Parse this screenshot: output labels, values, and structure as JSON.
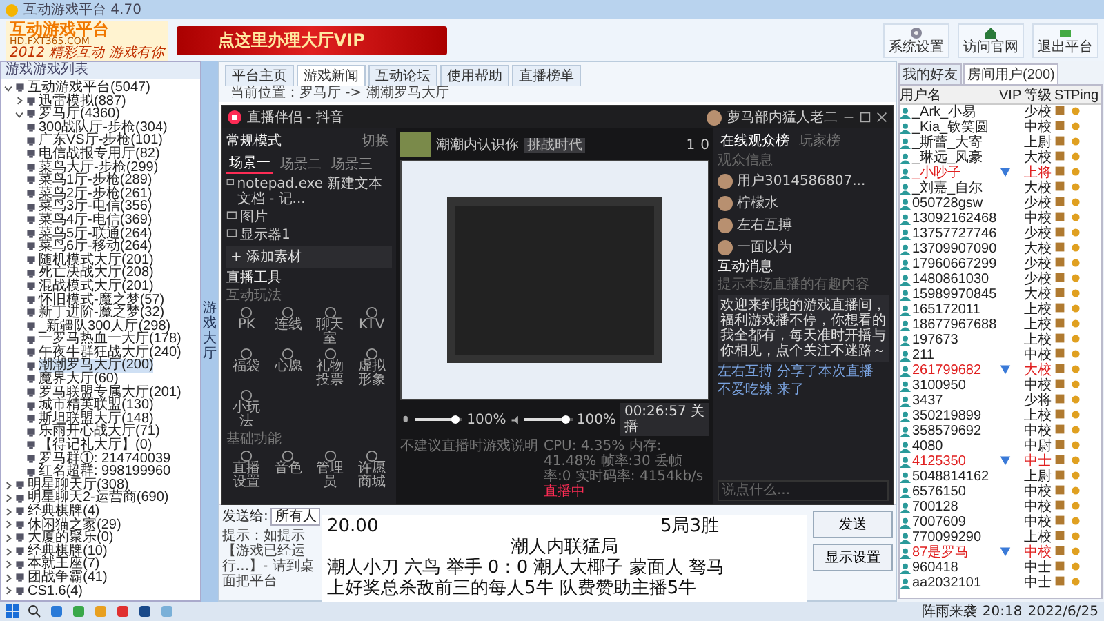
{
  "window": {
    "title": "互动游戏平台 4.70"
  },
  "header": {
    "logo": "互动游戏平台",
    "logo_url": "HD.FXT365.COM",
    "slogan": "2012 精彩互动 游戏有你",
    "banner": "点这里办理大厅VIP",
    "buttons": [
      "系统设置",
      "访问官网",
      "退出平台"
    ]
  },
  "tree": {
    "title": "游戏游戏列表",
    "items": [
      {
        "label": "互动游戏平台(5047)",
        "expanded": true,
        "selected": false,
        "children": [
          {
            "label": "迅雷模拟(887)",
            "expanded": false,
            "selected": false
          },
          {
            "label": "罗马厅(4360)",
            "expanded": true,
            "selected": false,
            "children": [
              {
                "label": "300战队厅-步枪(304)",
                "selected": false
              },
              {
                "label": "广东VS厅-步枪(101)",
                "selected": false
              },
              {
                "label": "电信战报专用厅(82)",
                "selected": false
              },
              {
                "label": "菜鸟大厅-步枪(299)",
                "selected": false
              },
              {
                "label": "菜鸟1厅-步枪(289)",
                "selected": false
              },
              {
                "label": "菜鸟2厅-步枪(261)",
                "selected": false
              },
              {
                "label": "菜鸟3厅-电信(356)",
                "selected": false
              },
              {
                "label": "菜鸟4厅-电信(369)",
                "selected": false
              },
              {
                "label": "菜鸟5厅-联通(264)",
                "selected": false
              },
              {
                "label": "菜鸟6厅-移动(264)",
                "selected": false
              },
              {
                "label": "随机模式大厅(201)",
                "selected": false
              },
              {
                "label": "死亡决战大厅(208)",
                "selected": false
              },
              {
                "label": "混战模式大厅(201)",
                "selected": false
              },
              {
                "label": "怀旧模式-魔之梦(57)",
                "selected": false
              },
              {
                "label": "新丁进阶-魔之梦(32)",
                "selected": false
              },
              {
                "label": "_新疆队300人厅(298)",
                "selected": false
              },
              {
                "label": "一罗马热血一大厅(178)",
                "selected": false
              },
              {
                "label": "午夜牛群狂战大厅(240)",
                "selected": false
              },
              {
                "label": "潮潮罗马大厅(200)",
                "selected": true
              },
              {
                "label": "魔界大厅(60)",
                "selected": false
              },
              {
                "label": "罗马联盟专属大厅(201)",
                "selected": false
              },
              {
                "label": "城市精英联盟(130)",
                "selected": false
              },
              {
                "label": "斯坦联盟大厅(148)",
                "selected": false
              },
              {
                "label": "乐雨开心战大厅(71)",
                "selected": false
              },
              {
                "label": "【得记礼大厅】(0)",
                "selected": false
              },
              {
                "label": "罗马群①: 214740039",
                "selected": false
              },
              {
                "label": "红名超群: 998199960",
                "selected": false
              }
            ]
          }
        ]
      },
      {
        "label": "明星聊天厅(308)",
        "expanded": false,
        "selected": false
      },
      {
        "label": "明星聊天2-运营商(690)",
        "expanded": false,
        "selected": false
      },
      {
        "label": "经典棋牌(4)",
        "expanded": false,
        "selected": false
      },
      {
        "label": "休闲猫之家(29)",
        "expanded": false,
        "selected": false
      },
      {
        "label": "大厦的聚乐(0)",
        "expanded": false,
        "selected": false
      },
      {
        "label": "经典棋牌(10)",
        "expanded": false,
        "selected": false
      },
      {
        "label": "本就王座(7)",
        "expanded": false,
        "selected": false
      },
      {
        "label": "团战争霸(41)",
        "expanded": false,
        "selected": false
      },
      {
        "label": "CS1.6(4)",
        "expanded": false,
        "selected": false
      }
    ]
  },
  "side_tab": "游戏大厅",
  "tabs": [
    {
      "label": "平台主页",
      "selected": false
    },
    {
      "label": "游戏新闻",
      "selected": true
    },
    {
      "label": "互动论坛",
      "selected": false
    },
    {
      "label": "使用帮助",
      "selected": false
    },
    {
      "label": "直播榜单",
      "selected": false
    }
  ],
  "breadcrumb": "当前位置：罗马厅 -> 潮潮罗马大厅",
  "chat": {
    "send_to_label": "发送给:",
    "send_to": "所有人",
    "hint": "提示：如提示【游戏已经运行...】- 请到桌面把平台",
    "buttons": [
      "发送",
      "显示设置"
    ]
  },
  "stream_app": {
    "title": "直播伴侣 - 抖音",
    "account": "萝马部内猛人老二",
    "mode": "常规模式",
    "switch": "切换",
    "scenes": [
      {
        "label": "场景一",
        "selected": true
      },
      {
        "label": "场景二",
        "selected": false
      },
      {
        "label": "场景三",
        "selected": false
      }
    ],
    "sources": [
      "notepad.exe 新建文本文档 - 记...",
      "图片",
      "显示器1"
    ],
    "add_source": "+ 添加素材",
    "tools_title": "直播工具",
    "groups": [
      {
        "title": "互动玩法",
        "tools": [
          "PK",
          "连线",
          "聊天室",
          "KTV",
          "福袋",
          "心愿",
          "礼物投票",
          "虚拟形象",
          "小玩法"
        ]
      },
      {
        "title": "基础功能",
        "tools": [
          "直播设置",
          "音色",
          "管理员",
          "许愿商城"
        ]
      }
    ],
    "room": {
      "name": "潮潮内认识你",
      "tag": "挑战时代",
      "counters": [
        "1",
        "0"
      ]
    },
    "mic": {
      "level": 0.85,
      "reading": "100%"
    },
    "speaker": {
      "level": 0.85,
      "reading": "100%"
    },
    "timer": "00:26:57 关播",
    "tip": "不建议直播时游戏说明",
    "stats": "CPU: 4.35%  内存: 41.48%  帧率:30  丢帧率:0  实时码率: 4154kb/s",
    "live_badge": "直播中",
    "audience": {
      "tabs": [
        {
          "label": "在线观众榜",
          "selected": true
        },
        {
          "label": "玩家榜",
          "selected": false
        }
      ],
      "subtitle": "观众信息",
      "viewers": [
        "用户3014586807...",
        "柠檬水",
        "左右互搏",
        "一面以为"
      ]
    },
    "messages": {
      "title": "互动消息",
      "empty": "提示本场直播的有趣内容",
      "welcome": "欢迎来到我的游戏直播间，福利游戏播不停，你想看的我全都有，每天准时开播与你相见，点个关注不迷路～",
      "events": [
        "左右互搏 分享了本次直播",
        "不爱吃辣 来了"
      ],
      "placeholder": "说点什么..."
    }
  },
  "score_board": {
    "time": "20.00",
    "format": "5局3胜",
    "title": "潮人内联猛局",
    "teams": "潮人小刀 六鸟 举手  0 :  0   潮人大椰子 蒙面人 驽马",
    "prize": "上好奖总杀敌前三的每人5牛     队费赞助主播5牛"
  },
  "users": {
    "tabs": [
      {
        "label": "我的好友",
        "selected": false
      },
      {
        "label": "房间用户(200)",
        "selected": true
      }
    ],
    "columns": [
      "用户名",
      "VIP",
      "等级",
      "ST",
      "Ping"
    ],
    "rows": [
      {
        "name": "_Ark_小易",
        "vip": false,
        "rank": "少校"
      },
      {
        "name": "_Kia_钦笑圆",
        "vip": false,
        "rank": "中校"
      },
      {
        "name": "_斯蕾_大寄",
        "vip": false,
        "rank": "上尉"
      },
      {
        "name": "_琳远_风豪",
        "vip": false,
        "rank": "大校"
      },
      {
        "name": "_小吵子",
        "vip": true,
        "rank": "上将"
      },
      {
        "name": "_刘嘉_自尔",
        "vip": false,
        "rank": "大校"
      },
      {
        "name": "050728gsw",
        "vip": false,
        "rank": "少校"
      },
      {
        "name": "13092162468",
        "vip": false,
        "rank": "中校"
      },
      {
        "name": "13757727746",
        "vip": false,
        "rank": "少校"
      },
      {
        "name": "13709907090",
        "vip": false,
        "rank": "大校"
      },
      {
        "name": "17960667299",
        "vip": false,
        "rank": "少校"
      },
      {
        "name": "1480861030",
        "vip": false,
        "rank": "少校"
      },
      {
        "name": "15989970845",
        "vip": false,
        "rank": "大校"
      },
      {
        "name": "165172011",
        "vip": false,
        "rank": "上校"
      },
      {
        "name": "18677967688",
        "vip": false,
        "rank": "上校"
      },
      {
        "name": "197673",
        "vip": false,
        "rank": "上校"
      },
      {
        "name": "211",
        "vip": false,
        "rank": "中校"
      },
      {
        "name": "261799682",
        "vip": true,
        "rank": "大校"
      },
      {
        "name": "3100950",
        "vip": false,
        "rank": "中校"
      },
      {
        "name": "3437",
        "vip": false,
        "rank": "少将"
      },
      {
        "name": "350219899",
        "vip": false,
        "rank": "上校"
      },
      {
        "name": "358579692",
        "vip": false,
        "rank": "中校"
      },
      {
        "name": "4080",
        "vip": false,
        "rank": "中尉"
      },
      {
        "name": "4125350",
        "vip": true,
        "rank": "中士"
      },
      {
        "name": "5048814162",
        "vip": false,
        "rank": "上尉"
      },
      {
        "name": "6576150",
        "vip": false,
        "rank": "中校"
      },
      {
        "name": "700128",
        "vip": false,
        "rank": "中校"
      },
      {
        "name": "7007609",
        "vip": false,
        "rank": "中校"
      },
      {
        "name": "770099290",
        "vip": false,
        "rank": "上校"
      },
      {
        "name": "87是罗马",
        "vip": true,
        "rank": "中校"
      },
      {
        "name": "960418",
        "vip": false,
        "rank": "中士"
      },
      {
        "name": "aa2032101",
        "vip": false,
        "rank": "中士"
      }
    ]
  },
  "taskbar": {
    "weather": "阵雨来袭",
    "time": "20:18",
    "date": "2022/6/25"
  }
}
